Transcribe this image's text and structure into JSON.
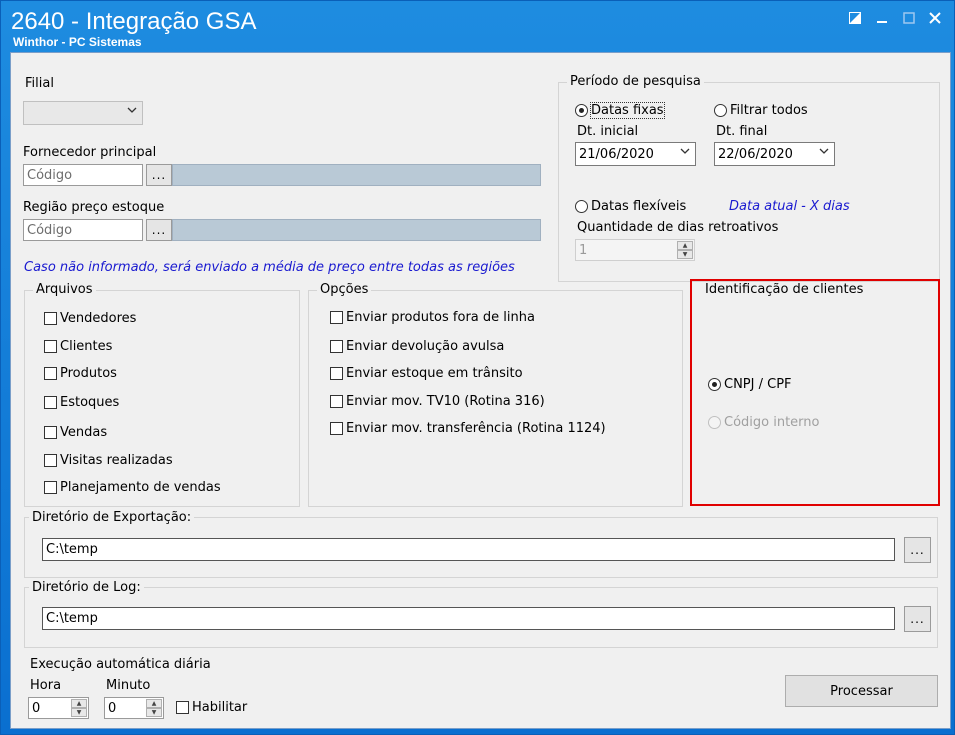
{
  "window": {
    "title": "2640 - Integração GSA",
    "subtitle": "Winthor - PC Sistemas"
  },
  "left": {
    "filial_label": "Filial",
    "fornecedor_label": "Fornecedor principal",
    "fornecedor_placeholder": "Código",
    "regiao_label": "Região preço estoque",
    "regiao_placeholder": "Código",
    "dots": "...",
    "info_text": "Caso não informado, será enviado a média de preço entre todas as regiões"
  },
  "periodo": {
    "title": "Período de pesquisa",
    "datas_fixas": "Datas fixas",
    "filtrar_todos": "Filtrar todos",
    "dt_inicial_label": "Dt. inicial",
    "dt_inicial_value": "21/06/2020",
    "dt_final_label": "Dt. final",
    "dt_final_value": "22/06/2020",
    "datas_flexiveis": "Datas flexíveis",
    "data_atual_hint": "Data atual - X dias",
    "qtd_dias_label": "Quantidade de dias retroativos",
    "qtd_dias_value": "1"
  },
  "arquivos": {
    "title": "Arquivos",
    "items": [
      "Vendedores",
      "Clientes",
      "Produtos",
      "Estoques",
      "Vendas",
      "Visitas realizadas",
      "Planejamento de vendas"
    ]
  },
  "opcoes": {
    "title": "Opções",
    "items": [
      "Enviar produtos fora de linha",
      "Enviar devolução avulsa",
      "Enviar estoque em trânsito",
      "Enviar mov. TV10 (Rotina 316)",
      "Enviar mov. transferência (Rotina 1124)"
    ]
  },
  "identificacao": {
    "title": "Identificação de clientes",
    "cnpj": "CNPJ / CPF",
    "codigo_interno": "Código interno"
  },
  "export_dir": {
    "title": "Diretório de Exportação:",
    "value": "C:\\temp",
    "dots": "..."
  },
  "log_dir": {
    "title": "Diretório de Log:",
    "value": "C:\\temp",
    "dots": "..."
  },
  "auto": {
    "title": "Execução automática diária",
    "hora_label": "Hora",
    "hora_value": "0",
    "minuto_label": "Minuto",
    "minuto_value": "0",
    "habilitar": "Habilitar"
  },
  "processar_label": "Processar",
  "colors": {
    "title_bar": "#1e8ce0",
    "highlight": "#e00000",
    "hint_blue": "#1a1ad0"
  }
}
